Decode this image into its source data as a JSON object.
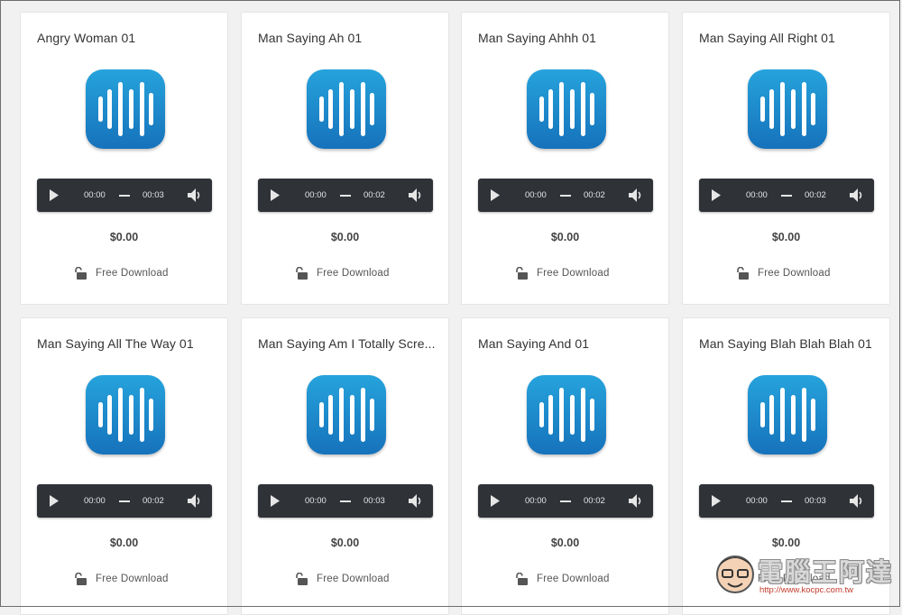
{
  "cards": [
    {
      "title": "Angry Woman 01",
      "current": "00:00",
      "duration": "00:03",
      "price": "$0.00",
      "download": "Free Download"
    },
    {
      "title": "Man Saying Ah 01",
      "current": "00:00",
      "duration": "00:02",
      "price": "$0.00",
      "download": "Free Download"
    },
    {
      "title": "Man Saying Ahhh 01",
      "current": "00:00",
      "duration": "00:02",
      "price": "$0.00",
      "download": "Free Download"
    },
    {
      "title": "Man Saying All Right 01",
      "current": "00:00",
      "duration": "00:02",
      "price": "$0.00",
      "download": "Free Download"
    },
    {
      "title": "Man Saying All The Way 01",
      "current": "00:00",
      "duration": "00:02",
      "price": "$0.00",
      "download": "Free Download"
    },
    {
      "title": "Man Saying Am I Totally Scre...",
      "current": "00:00",
      "duration": "00:03",
      "price": "$0.00",
      "download": "Free Download"
    },
    {
      "title": "Man Saying And 01",
      "current": "00:00",
      "duration": "00:02",
      "price": "$0.00",
      "download": "Free Download"
    },
    {
      "title": "Man Saying Blah Blah Blah 01",
      "current": "00:00",
      "duration": "00:03",
      "price": "$0.00",
      "download": "Free Download"
    }
  ],
  "icons": {
    "app": "sound-wave-icon",
    "play": "play-icon",
    "volume": "volume-icon",
    "lock": "unlock-icon"
  },
  "colors": {
    "icon_top": "#26a3dc",
    "icon_bottom": "#1672bb",
    "player_bg": "#2f3237",
    "page_bg": "#f1f1f2"
  },
  "watermark": {
    "text": "電腦王阿達",
    "url": "http://www.kocpc.com.tw"
  }
}
